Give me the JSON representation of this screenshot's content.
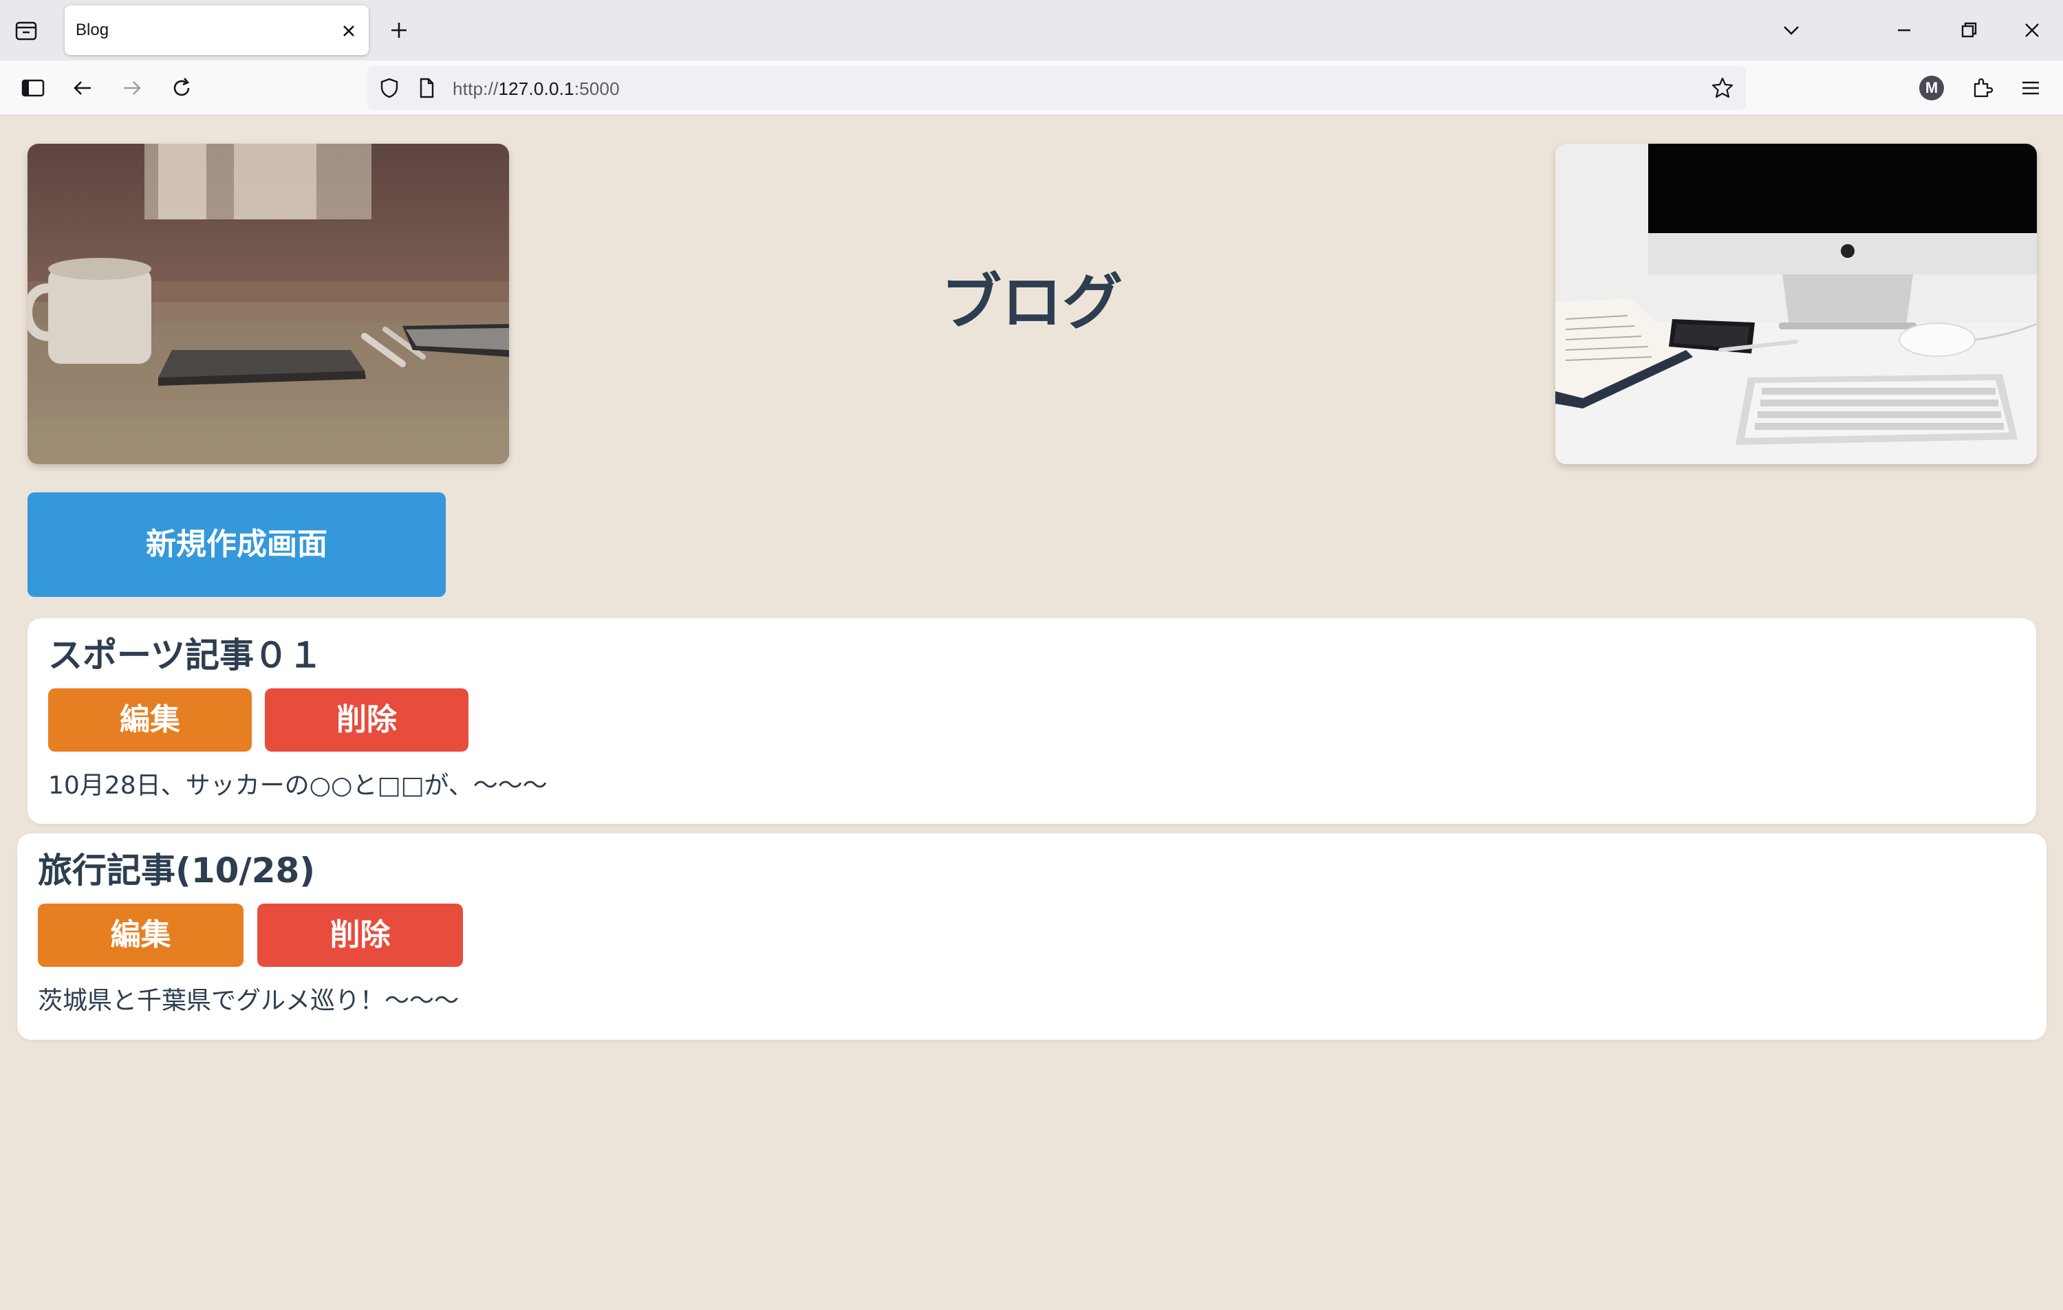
{
  "browser": {
    "tab_title": "Blog",
    "url_prefix": "http://",
    "url_host": "127.0.0.1",
    "url_port": ":5000",
    "profile_initial": "M"
  },
  "page": {
    "title": "ブログ",
    "new_button_label": "新規作成画面",
    "colors": {
      "background": "#ede4d9",
      "new_button": "#3498db",
      "edit_button": "#e67e22",
      "delete_button": "#e74c3c",
      "text": "#2c3e50"
    }
  },
  "posts": [
    {
      "title": "スポーツ記事０１",
      "edit_label": "編集",
      "delete_label": "削除",
      "body": "10月28日、サッカーの○○と□□が、～～～"
    },
    {
      "title": "旅行記事(10/28)",
      "edit_label": "編集",
      "delete_label": "削除",
      "body": "茨城県と千葉県でグルメ巡り！～～～"
    }
  ]
}
